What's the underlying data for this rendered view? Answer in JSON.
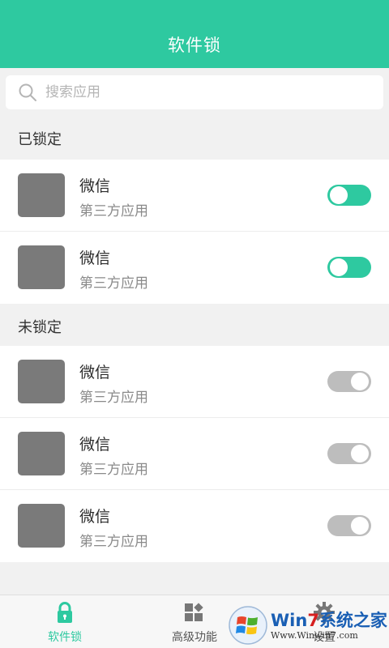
{
  "header": {
    "title": "软件锁"
  },
  "search": {
    "placeholder": "搜索应用"
  },
  "sections": {
    "locked": {
      "title": "已锁定",
      "items": [
        {
          "name": "微信",
          "desc": "第三方应用",
          "locked": true
        },
        {
          "name": "微信",
          "desc": "第三方应用",
          "locked": true
        }
      ]
    },
    "unlocked": {
      "title": "未锁定",
      "items": [
        {
          "name": "微信",
          "desc": "第三方应用",
          "locked": false
        },
        {
          "name": "微信",
          "desc": "第三方应用",
          "locked": false
        },
        {
          "name": "微信",
          "desc": "第三方应用",
          "locked": false
        }
      ]
    }
  },
  "nav": {
    "items": [
      {
        "label": "软件锁",
        "icon": "lock-icon",
        "active": true
      },
      {
        "label": "高级功能",
        "icon": "grid-icon",
        "active": false
      },
      {
        "label": "设置",
        "icon": "gear-icon",
        "active": false
      }
    ]
  },
  "watermark": {
    "title_a": "Win",
    "title_b": "7",
    "title_c": "系统之家",
    "url": "Www.Winwin7.com"
  },
  "colors": {
    "accent": "#2ec9a0",
    "toggle_off": "#bdbdbd",
    "app_icon": "#7a7a7a"
  }
}
